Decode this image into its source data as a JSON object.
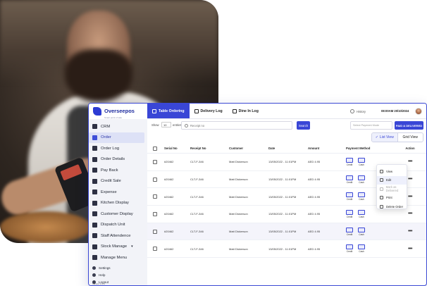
{
  "app": {
    "brand": "Overseepos",
    "brand_tagline": "Smart point of sale",
    "version": "Version 1.0.0"
  },
  "sidebar": {
    "items": [
      {
        "label": "CRM",
        "icon": "crm-icon"
      },
      {
        "label": "Order",
        "icon": "order-icon",
        "active": true
      },
      {
        "label": "Order Log",
        "icon": "order-log-icon"
      },
      {
        "label": "Order Details",
        "icon": "order-details-icon"
      },
      {
        "label": "Pay Back",
        "icon": "pay-back-icon"
      },
      {
        "label": "Credit Sale",
        "icon": "credit-sale-icon"
      },
      {
        "label": "Expense",
        "icon": "expense-icon"
      },
      {
        "label": "Kitchen Display",
        "icon": "kitchen-display-icon"
      },
      {
        "label": "Customer Display",
        "icon": "customer-display-icon"
      },
      {
        "label": "Dispatch Unit",
        "icon": "dispatch-unit-icon"
      },
      {
        "label": "Staff Attendence",
        "icon": "staff-attendance-icon"
      },
      {
        "label": "Stock Manage",
        "icon": "stock-manage-icon",
        "caret": "▾"
      },
      {
        "label": "Manage Menu",
        "icon": "manage-menu-icon"
      }
    ],
    "sub_items": [
      {
        "label": "Settings",
        "icon": "settings-icon"
      },
      {
        "label": "Help",
        "icon": "help-icon"
      },
      {
        "label": "Logout",
        "icon": "logout-icon"
      }
    ]
  },
  "topbar": {
    "tabs": [
      {
        "label": "Table Ordering",
        "icon": "table-ordering-icon",
        "active": true
      },
      {
        "label": "Delivery Log",
        "icon": "delivery-log-icon"
      },
      {
        "label": "Dine In Log",
        "icon": "dine-in-log-icon"
      }
    ],
    "history_label": "History",
    "datetime": "08:00AM 20/10/2024"
  },
  "filters": {
    "show_label": "Show",
    "show_value": "10",
    "entries_label": "entries",
    "search_placeholder": "Receipt no",
    "search_button": "Search",
    "payment_placeholder": "Select Payment Mode",
    "paid_button": "PAID & DELIVERED"
  },
  "view_toggle": {
    "list_label": "List View",
    "grid_label": "Grid View"
  },
  "table": {
    "headers": [
      "Serial No",
      "Receipt No",
      "Customer",
      "Date",
      "Amount",
      "Payment Method",
      "Action"
    ],
    "rows": [
      {
        "serial": "#20462",
        "receipt": "CLT-F-346",
        "customer": "Matt Dickerson",
        "date": "13/05/2022 - 11:01PM",
        "amount": "AED 4.95"
      },
      {
        "serial": "#20462",
        "receipt": "CLT-F-346",
        "customer": "Matt Dickerson",
        "date": "13/05/2022 - 11:01PM",
        "amount": "AED 4.95"
      },
      {
        "serial": "#20462",
        "receipt": "CLT-F-346",
        "customer": "Matt Dickerson",
        "date": "13/05/2022 - 11:01PM",
        "amount": "AED 4.95"
      },
      {
        "serial": "#20462",
        "receipt": "CLT-F-346",
        "customer": "Matt Dickerson",
        "date": "13/05/2022 - 11:01PM",
        "amount": "AED 4.95"
      },
      {
        "serial": "#20462",
        "receipt": "CLT-F-346",
        "customer": "Matt Dickerson",
        "date": "13/05/2022 - 11:01PM",
        "amount": "AED 4.95"
      },
      {
        "serial": "#20462",
        "receipt": "CLT-F-346",
        "customer": "Matt Dickerson",
        "date": "13/05/2022 - 11:01PM",
        "amount": "AED 4.95"
      }
    ],
    "payment_labels": [
      "Credit",
      "Cash"
    ],
    "action_glyph": "•••"
  },
  "context_menu": {
    "items": [
      {
        "label": "View",
        "icon": "eye-icon"
      },
      {
        "label": "Edit",
        "icon": "edit-icon"
      },
      {
        "label": "Mark as Delivered",
        "icon": "check-icon",
        "disabled": true
      },
      {
        "label": "Print",
        "icon": "print-icon"
      },
      {
        "label": "Delete Order",
        "icon": "trash-icon"
      }
    ]
  },
  "colors": {
    "accent": "#3946d6",
    "sidebar_bg": "#f2f3f8",
    "active_nav": "#dde1f6"
  }
}
